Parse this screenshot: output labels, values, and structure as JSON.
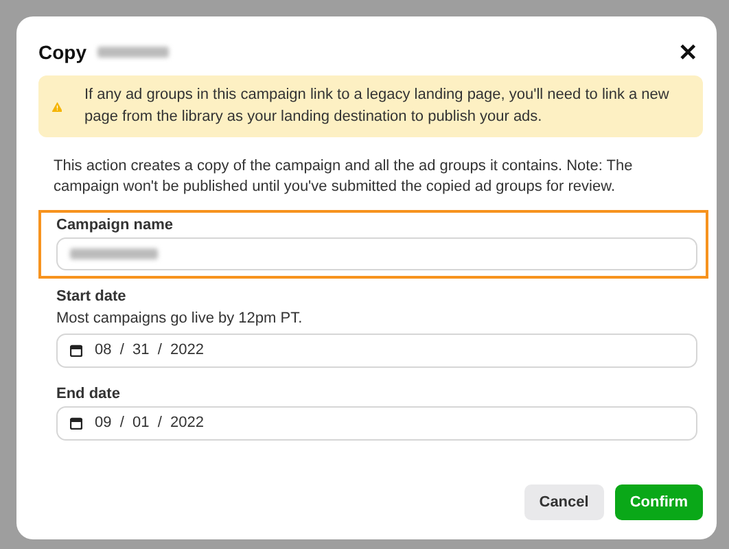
{
  "dialog": {
    "title": "Copy",
    "title_redacted": true,
    "close_label": "✕"
  },
  "alert": {
    "kind": "warning",
    "text": "If any ad groups in this campaign link to a legacy landing page, you'll need to link a new page from the library as your landing destination to publish your ads."
  },
  "description": "This action creates a copy of the campaign and all the ad groups it contains. Note: The campaign won't be published until you've submitted the copied ad groups for review.",
  "fields": [
    {
      "kind": "text",
      "label": "Campaign name",
      "value_redacted": true,
      "highlighted": true
    },
    {
      "kind": "date",
      "label": "Start date",
      "hint": "Most campaigns go live by 12pm PT.",
      "value": "08  /  31  /  2022",
      "highlighted": false
    },
    {
      "kind": "date",
      "label": "End date",
      "value": "09  /  01  /  2022",
      "highlighted": false
    }
  ],
  "buttons": [
    {
      "label": "Cancel",
      "kind": "secondary"
    },
    {
      "label": "Confirm",
      "kind": "primary"
    }
  ]
}
